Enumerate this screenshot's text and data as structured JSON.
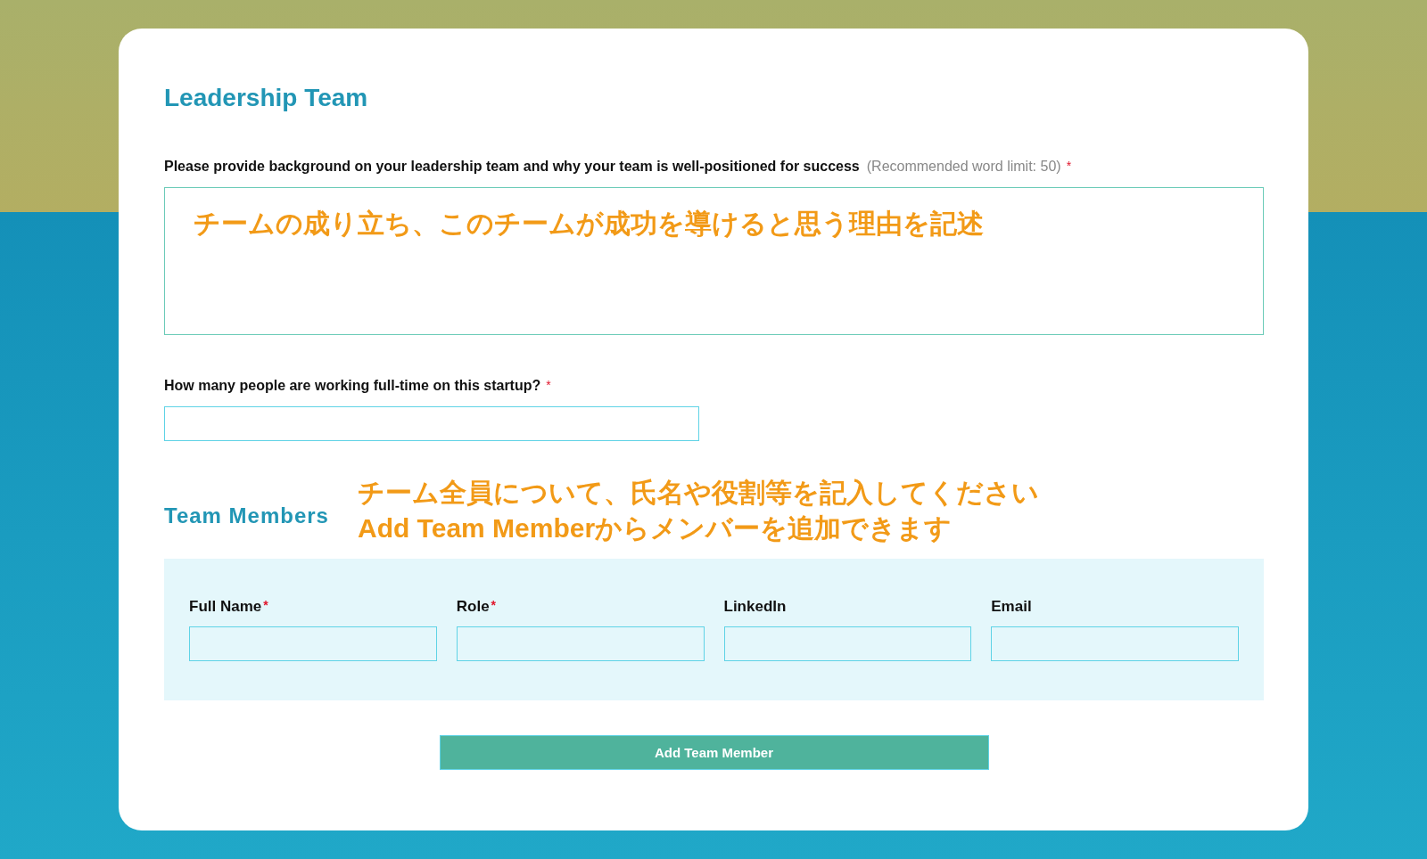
{
  "section_title": "Leadership Team",
  "required_mark": "*",
  "background_question": {
    "label": "Please provide background on your leadership team and why your team is well-positioned for success",
    "hint": "(Recommended word limit: 50)",
    "required": true,
    "annotation": "チームの成り立ち、このチームが成功を導けると思う理由を記述"
  },
  "fulltime_question": {
    "label": "How many people are working full-time on this startup?",
    "required": true
  },
  "team_members": {
    "title": "Team Members",
    "annotation_lines": [
      "チーム全員について、氏名や役割等を記入してください",
      "**Add Team Member**からメンバーを追加できます"
    ],
    "columns": [
      {
        "label": "Full Name",
        "required": true
      },
      {
        "label": "Role",
        "required": true
      },
      {
        "label": "LinkedIn",
        "required": false
      },
      {
        "label": "Email",
        "required": false
      }
    ]
  },
  "add_button": "Add Team Member"
}
